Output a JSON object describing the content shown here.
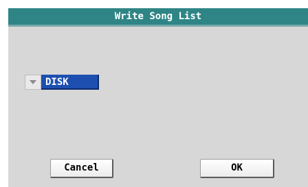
{
  "dialog": {
    "title": "Write Song List",
    "destination": {
      "icon": "chevron-down-icon",
      "value": "DISK"
    },
    "buttons": {
      "cancel_label": "Cancel",
      "ok_label": "OK"
    }
  },
  "colors": {
    "title_bar": "#2f8585",
    "dialog_background": "#d7d7d7",
    "selected_value_background": "#1d4fb0"
  }
}
